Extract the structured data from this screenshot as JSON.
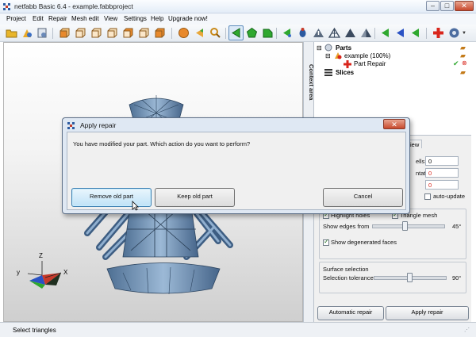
{
  "window": {
    "title": "netfabb Basic 6.4 - example.fabbproject"
  },
  "menu": [
    "Project",
    "Edit",
    "Repair",
    "Mesh edit",
    "View",
    "Settings",
    "Help",
    "Upgrade now!"
  ],
  "side_tab": {
    "label": "Context area"
  },
  "tree": {
    "parts": "Parts",
    "model": "example (100%)",
    "part_repair": "Part Repair",
    "slices": "Slices"
  },
  "repair_panel": {
    "tab_fragment": "iew",
    "shells_label_fragment": "ells:",
    "shells_value": "0",
    "orientation_label_fragment": "ntation",
    "orientation_value": "0",
    "holes_value": "0",
    "auto_update": "auto-update",
    "highlight_holes": "Highlight holes",
    "triangle_mesh": "Triangle mesh",
    "show_edges_from": "Show edges from",
    "edges_angle": "45°",
    "edges_slider_fraction": 0.45,
    "show_degenerated": "Show degenerated faces",
    "surface_selection": "Surface selection",
    "selection_tolerance": "Selection tolerance",
    "tolerance_value": "90°",
    "tolerance_slider_fraction": 0.5,
    "automatic_repair": "Automatic repair",
    "apply_repair": "Apply repair"
  },
  "dialog": {
    "title": "Apply repair",
    "message": "You have modified your part. Which action do you want to perform?",
    "remove_button": "Remove old part",
    "keep_button": "Keep old part",
    "cancel_button": "Cancel"
  },
  "axes": {
    "x": "X",
    "y": "y",
    "z": "Z"
  },
  "status": {
    "text": "Select triangles"
  },
  "colors": {
    "accent": "#3c7fb1",
    "model": "#6f8fb0",
    "error": "#d9261c"
  }
}
